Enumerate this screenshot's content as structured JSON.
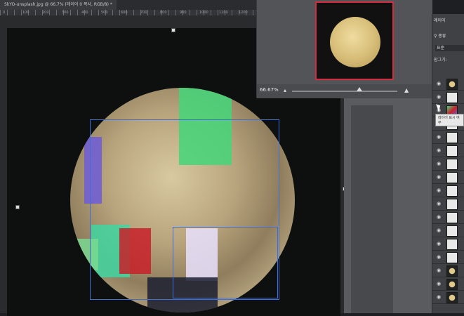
{
  "document": {
    "tab_title": "SkYO-unsplash.jpg @ 66.7% (레이어 0 복사, RGB/8) *",
    "ruler_labels": [
      "0",
      "100",
      "200",
      "300",
      "400",
      "500",
      "600",
      "700",
      "800",
      "900",
      "1000",
      "1100",
      "1200",
      "1300"
    ]
  },
  "navigator": {
    "zoom": "66.67%"
  },
  "layers": {
    "tab_label": "레이어",
    "search_label": "종류",
    "blend_mode": "표준",
    "lock_label": "잠그기:",
    "tooltip": "레이어 표시 여부",
    "rows": [
      {
        "thumb": "moon"
      },
      {
        "thumb": "white"
      },
      {
        "thumb": "colored"
      },
      {
        "thumb": "white"
      },
      {
        "thumb": "white"
      },
      {
        "thumb": "white"
      },
      {
        "thumb": "white"
      },
      {
        "thumb": "white"
      },
      {
        "thumb": "white"
      },
      {
        "thumb": "white"
      },
      {
        "thumb": "white"
      },
      {
        "thumb": "white"
      },
      {
        "thumb": "white"
      },
      {
        "thumb": "white"
      },
      {
        "thumb": "moon"
      },
      {
        "thumb": "moon"
      },
      {
        "thumb": "moon"
      }
    ]
  },
  "colors": {
    "selection": "#3d6fd6",
    "navigator_frame": "#d42d3f",
    "patch_green": "#44d67a",
    "patch_purple": "#6f5cd8",
    "patch_red": "#c8202a",
    "patch_teal": "#3fd6c0",
    "patch_white": "#e8e0ff"
  }
}
